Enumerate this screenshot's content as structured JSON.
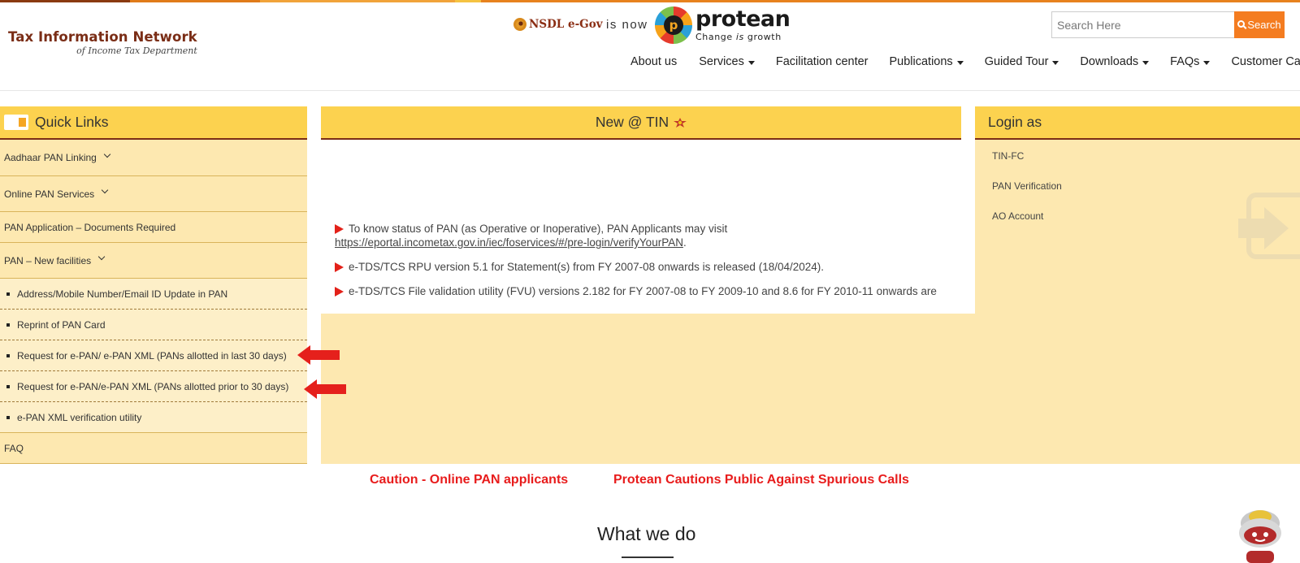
{
  "header": {
    "brand_title": "Tax Information Network",
    "brand_subtitle": "of Income Tax Department",
    "nsdl_text": "NSDL e-Gov",
    "is_now": "is now",
    "protean_name": "protean",
    "protean_tag_prefix": "Change ",
    "protean_tag_italic": "is",
    "protean_tag_suffix": " growth",
    "search_placeholder": "Search Here",
    "search_button": "Search"
  },
  "nav": [
    {
      "label": "About us",
      "dropdown": false
    },
    {
      "label": "Services",
      "dropdown": true
    },
    {
      "label": "Facilitation center",
      "dropdown": false
    },
    {
      "label": "Publications",
      "dropdown": true
    },
    {
      "label": "Guided Tour",
      "dropdown": true
    },
    {
      "label": "Downloads",
      "dropdown": true
    },
    {
      "label": "FAQs",
      "dropdown": true
    },
    {
      "label": "Customer Care",
      "dropdown": true
    }
  ],
  "quick_links": {
    "title": "Quick Links",
    "items": [
      {
        "label": "Aadhaar PAN Linking",
        "expandable": true
      },
      {
        "label": "Online PAN Services",
        "expandable": true
      },
      {
        "label": "PAN Application – Documents Required",
        "expandable": false
      },
      {
        "label": "PAN – New facilities",
        "expandable": true
      }
    ],
    "sub_items": [
      "Address/Mobile Number/Email ID Update in PAN",
      "Reprint of PAN Card",
      "Request for e-PAN/ e-PAN XML (PANs allotted in last 30 days)",
      "Request for e-PAN/e-PAN XML (PANs allotted prior to 30 days)",
      "e-PAN XML verification utility"
    ],
    "faq": "FAQ"
  },
  "news": {
    "title": "New @ TIN",
    "items": [
      {
        "text": "To know status of PAN (as Operative or Inoperative), PAN Applicants may visit",
        "link": "https://eportal.incometax.gov.in/iec/foservices/#/pre-login/verifyYourPAN",
        "link_suffix": "."
      },
      {
        "text": "e-TDS/TCS RPU version 5.1 for Statement(s) from FY 2007-08 onwards is released (18/04/2024).",
        "link": "",
        "link_suffix": ""
      },
      {
        "text": "e-TDS/TCS File validation utility (FVU) versions 2.182 for FY 2007-08 to FY 2009-10 and 8.6 for FY 2010-11 onwards are",
        "link": "",
        "link_suffix": ""
      }
    ]
  },
  "login": {
    "title": "Login as",
    "items": [
      "TIN-FC",
      "PAN Verification",
      "AO Account"
    ]
  },
  "cautions": [
    "Caution - Online PAN applicants",
    "Protean Cautions Public Against Spurious Calls"
  ],
  "section_title": "What we do",
  "colors": {
    "panel_header": "#fcd24f",
    "panel_body": "#fde8b0",
    "brand": "#7a2d16",
    "search_button": "#f47c20",
    "caution_red": "#e81c1c"
  }
}
